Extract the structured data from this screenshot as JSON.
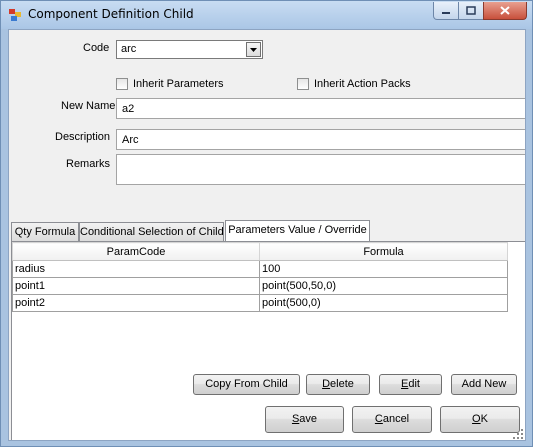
{
  "window": {
    "title": "Component Definition Child"
  },
  "form": {
    "code_label": "Code",
    "code_value": "arc",
    "inherit_parameters_label": "Inherit Parameters",
    "inherit_action_packs_label": "Inherit Action Packs",
    "new_name_label": "New Name",
    "new_name_value": "a2",
    "description_label": "Description",
    "description_value": "Arc",
    "remarks_label": "Remarks",
    "remarks_value": ""
  },
  "tabs": [
    {
      "label": "Qty Formula"
    },
    {
      "label": "Conditional Selection of Child"
    },
    {
      "label": "Parameters Value / Override"
    }
  ],
  "grid": {
    "columns": [
      "ParamCode",
      "Formula"
    ],
    "rows": [
      {
        "param": "radius",
        "formula": "100"
      },
      {
        "param": "point1",
        "formula": "point(500,50,0)"
      },
      {
        "param": "point2",
        "formula": "point(500,0)"
      }
    ]
  },
  "grid_buttons": {
    "copy_from_child": "Copy From Child",
    "delete_first": "D",
    "delete_rest": "elete",
    "edit_first": "E",
    "edit_rest": "dit",
    "add_new": "Add New"
  },
  "dialog_buttons": {
    "save_first": "S",
    "save_rest": "ave",
    "cancel_first": "C",
    "cancel_rest": "ancel",
    "ok_first": "O",
    "ok_rest": "K"
  },
  "colors": {
    "frame": "#a9c3e0",
    "client": "#f0f0f0",
    "close_button": "#c8503c"
  }
}
